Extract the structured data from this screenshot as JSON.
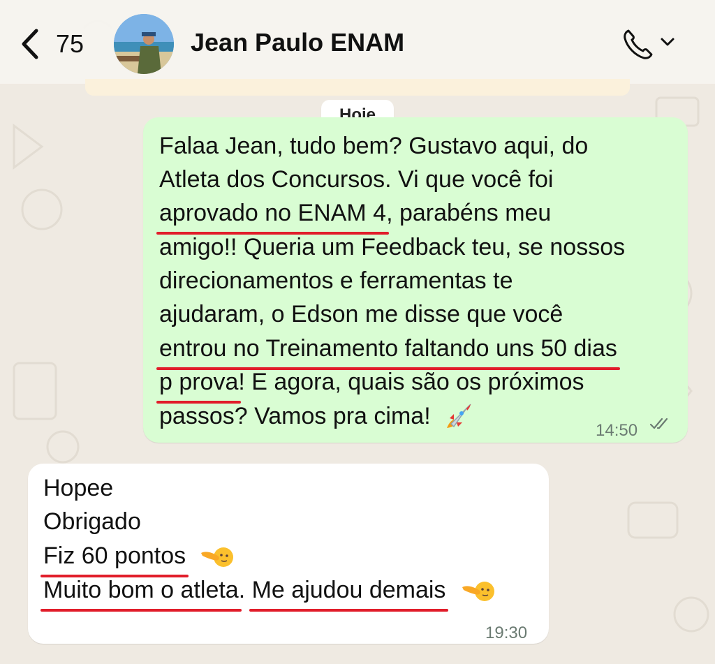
{
  "header": {
    "unread_count": "75",
    "contact_name": "Jean Paulo ENAM"
  },
  "date_chip": "Hoje",
  "messages": [
    {
      "direction": "outgoing",
      "lines": [
        [
          "Falaa Jean, tudo bem? Gustavo aqui, do"
        ],
        [
          "Atleta dos Concursos. Vi que você foi"
        ],
        [
          "aprovado no ENAM 4",
          ", parabéns meu"
        ],
        [
          "amigo!! Queria um Feedback teu, se nossos"
        ],
        [
          "direcionamentos e ferramentas te"
        ],
        [
          "ajudaram, o Edson me disse que você"
        ],
        [
          "entrou no Treinamento faltando uns 50 dias"
        ],
        [
          "p prova",
          "! E agora, quais são os próximos"
        ],
        [
          "passos? Vamos pra cima!"
        ]
      ],
      "time": "14:50",
      "status": "read"
    },
    {
      "direction": "incoming",
      "lines": [
        [
          "Hopee"
        ],
        [
          "Obrigado"
        ],
        [
          "Fiz 60 pontos"
        ],
        [
          "Muito bom o atleta",
          ". ",
          "Me ajudou demais"
        ]
      ],
      "time": "19:30"
    }
  ],
  "colors": {
    "outgoing_bubble": "#d9fdd3",
    "incoming_bubble": "#ffffff",
    "chat_background": "#efeae2",
    "underline": "#e11d2a"
  },
  "icons": [
    "back-chevron-icon",
    "phone-icon",
    "chevron-down-icon",
    "rocket-emoji",
    "pointing-emoji",
    "double-check-icon"
  ]
}
